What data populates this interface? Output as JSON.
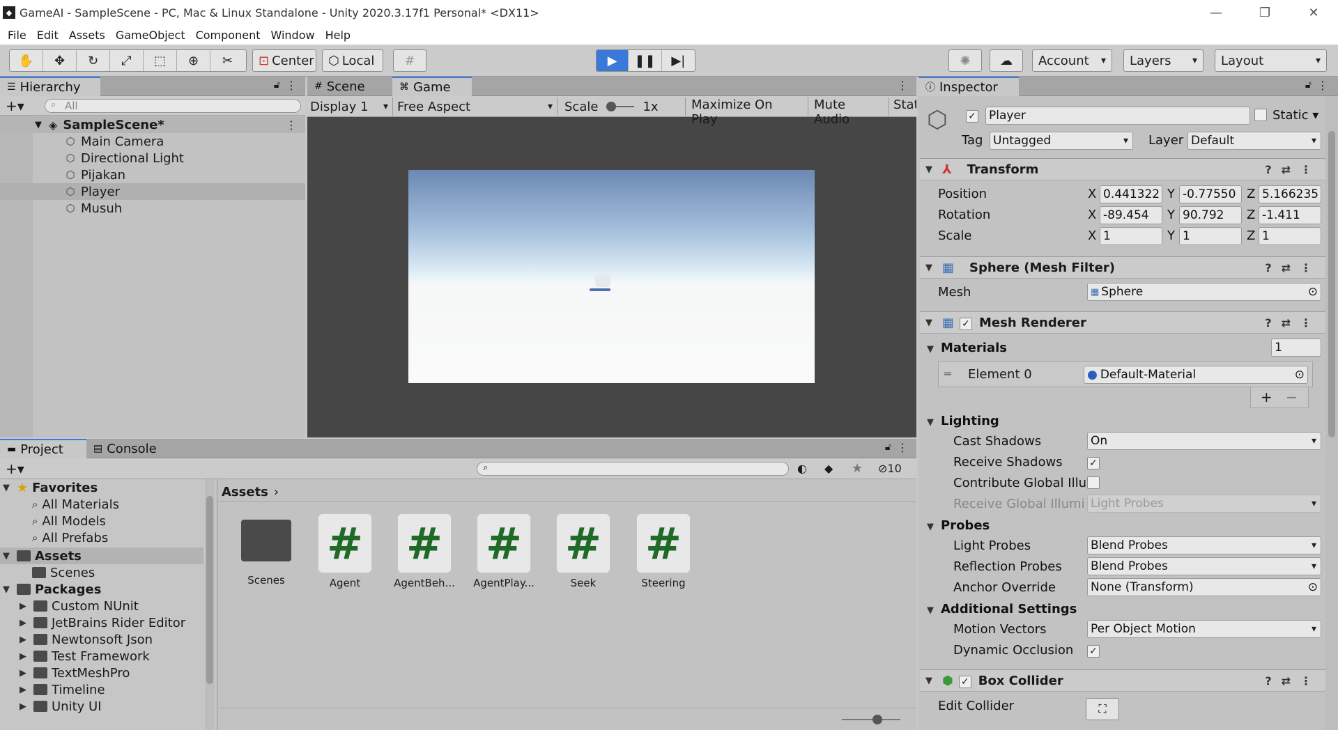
{
  "window": {
    "title": "GameAI - SampleScene - PC, Mac & Linux Standalone - Unity 2020.3.17f1 Personal* <DX11>"
  },
  "menu": [
    "File",
    "Edit",
    "Assets",
    "GameObject",
    "Component",
    "Window",
    "Help"
  ],
  "toolbar": {
    "pivot": "Center",
    "space": "Local",
    "account": "Account",
    "layers": "Layers",
    "layout": "Layout"
  },
  "hierarchy": {
    "tab": "Hierarchy",
    "search_placeholder": "All",
    "scene": "SampleScene*",
    "items": [
      "Main Camera",
      "Directional Light",
      "Pijakan",
      "Player",
      "Musuh"
    ]
  },
  "game": {
    "tabs": [
      "Scene",
      "Game"
    ],
    "display": "Display 1",
    "aspect": "Free Aspect",
    "scale_label": "Scale",
    "scale_value": "1x",
    "maximize": "Maximize On Play",
    "mute": "Mute Audio",
    "stats": "Stat"
  },
  "project": {
    "tabs": [
      "Project",
      "Console"
    ],
    "hidden_count": "10",
    "breadcrumb": "Assets",
    "favorites_label": "Favorites",
    "favorites": [
      "All Materials",
      "All Models",
      "All Prefabs"
    ],
    "assets_label": "Assets",
    "assets_children": [
      "Scenes"
    ],
    "packages_label": "Packages",
    "packages": [
      "Custom NUnit",
      "JetBrains Rider Editor",
      "Newtonsoft Json",
      "Test Framework",
      "TextMeshPro",
      "Timeline",
      "Unity UI"
    ],
    "grid": [
      {
        "name": "Scenes",
        "type": "folder"
      },
      {
        "name": "Agent",
        "type": "script"
      },
      {
        "name": "AgentBeh...",
        "type": "script"
      },
      {
        "name": "AgentPlay...",
        "type": "script"
      },
      {
        "name": "Seek",
        "type": "script"
      },
      {
        "name": "Steering",
        "type": "script"
      }
    ]
  },
  "inspector": {
    "tab": "Inspector",
    "object_name": "Player",
    "static_label": "Static",
    "tag_label": "Tag",
    "tag_value": "Untagged",
    "layer_label": "Layer",
    "layer_value": "Default",
    "transform": {
      "title": "Transform",
      "position_label": "Position",
      "rotation_label": "Rotation",
      "scale_label": "Scale",
      "position": [
        "0.441322",
        "-0.77550",
        "5.166235"
      ],
      "rotation": [
        "-89.454",
        "90.792",
        "-1.411"
      ],
      "scale": [
        "1",
        "1",
        "1"
      ],
      "axes": [
        "X",
        "Y",
        "Z"
      ]
    },
    "mesh_filter": {
      "title": "Sphere (Mesh Filter)",
      "mesh_label": "Mesh",
      "mesh_value": "Sphere"
    },
    "mesh_renderer": {
      "title": "Mesh Renderer",
      "materials_label": "Materials",
      "materials_count": "1",
      "element_label": "Element 0",
      "element_value": "Default-Material",
      "lighting_label": "Lighting",
      "cast_shadows_label": "Cast Shadows",
      "cast_shadows_value": "On",
      "receive_shadows_label": "Receive Shadows",
      "contribute_gi_label": "Contribute Global Illui",
      "receive_gi_label": "Receive Global Illumi",
      "receive_gi_value": "Light Probes",
      "probes_label": "Probes",
      "light_probes_label": "Light Probes",
      "light_probes_value": "Blend Probes",
      "reflection_probes_label": "Reflection Probes",
      "reflection_probes_value": "Blend Probes",
      "anchor_label": "Anchor Override",
      "anchor_value": "None (Transform)",
      "additional_label": "Additional Settings",
      "motion_vectors_label": "Motion Vectors",
      "motion_vectors_value": "Per Object Motion",
      "dynamic_occlusion_label": "Dynamic Occlusion"
    },
    "box_collider": {
      "title": "Box Collider",
      "edit_label": "Edit Collider"
    }
  },
  "colors": {
    "play_active": "#3a79d9",
    "script_hash": "#1f6a26",
    "panel_bg": "#c2c2c2"
  }
}
